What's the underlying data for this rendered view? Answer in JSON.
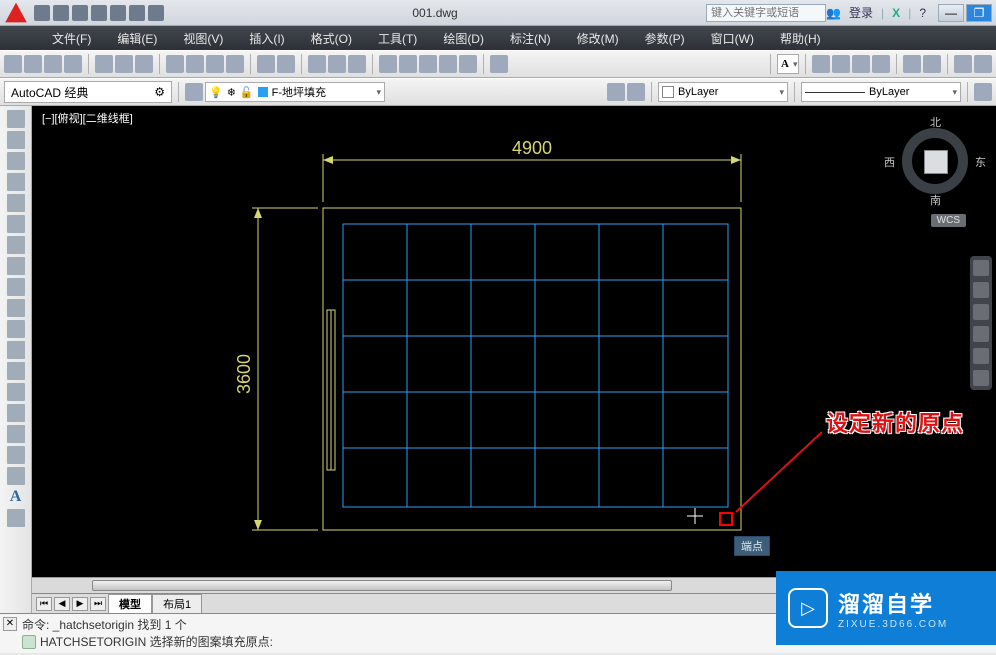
{
  "title": "001.dwg",
  "search_placeholder": "键入关键字或短语",
  "login_label": "登录",
  "menus": [
    "文件(F)",
    "编辑(E)",
    "视图(V)",
    "插入(I)",
    "格式(O)",
    "工具(T)",
    "绘图(D)",
    "标注(N)",
    "修改(M)",
    "参数(P)",
    "窗口(W)",
    "帮助(H)"
  ],
  "workspace": "AutoCAD 经典",
  "layer_name": "F-地坪填充",
  "layer_bylayer": "ByLayer",
  "linetype_bylayer": "ByLayer",
  "viewport_label": "[−][俯视][二维线框]",
  "compass": {
    "n": "北",
    "s": "南",
    "e": "东",
    "w": "西"
  },
  "wcs": "WCS",
  "dim_top": "4900",
  "dim_left": "3600",
  "callout_text": "设定新的原点",
  "tooltip": "端点",
  "tabs": {
    "model": "模型",
    "layout": "布局1"
  },
  "cmd_line1": "命令: _hatchsetorigin 找到 1 个",
  "cmd_line2": "HATCHSETORIGIN 选择新的图案填充原点:",
  "watermark": {
    "big": "溜溜自学",
    "small": "ZIXUE.3D66.COM"
  },
  "title_icons": [
    "new",
    "open",
    "save",
    "saveas",
    "print",
    "undo",
    "redo"
  ],
  "toolbar1_icons": [
    "new",
    "open",
    "save",
    "saveas",
    "print",
    "preview",
    "publish",
    "cut",
    "copy",
    "paste",
    "match",
    "undo",
    "redo",
    "pan",
    "zoom",
    "zoomext",
    "props",
    "sheet",
    "tool",
    "render",
    "help"
  ],
  "left_tools": [
    "line",
    "xline",
    "pline",
    "polygon",
    "rect",
    "arc",
    "circle",
    "revcloud",
    "spline",
    "ellipse",
    "ellarc",
    "insert",
    "block",
    "point",
    "hatch",
    "gradient",
    "region",
    "table",
    "text",
    "addsel"
  ],
  "nav_tools": [
    "wheel",
    "pan",
    "zoom",
    "orbit",
    "showui",
    "settings"
  ]
}
